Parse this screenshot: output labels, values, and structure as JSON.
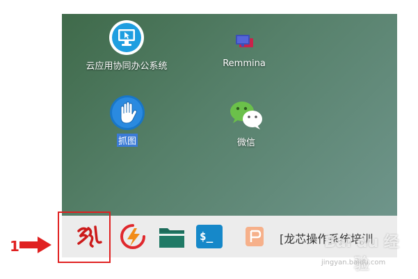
{
  "desktop": {
    "icons": [
      {
        "label": "云应用协同办公系统",
        "icon": "monitor-cursor-icon"
      },
      {
        "label": "Remmina",
        "icon": "remmina-icon"
      },
      {
        "label": "抓图",
        "icon": "hand-icon"
      },
      {
        "label": "微信",
        "icon": "wechat-icon"
      }
    ]
  },
  "taskbar": {
    "start_icon": "start-menu-logo-icon",
    "window_title": "[龙芯操作系统培训"
  },
  "annotation": {
    "number": "1"
  },
  "watermark": {
    "main": "Bai du 经验",
    "sub": "jingyan.baidu.com"
  },
  "colors": {
    "annotation": "#e02020",
    "taskbar": "#ececec",
    "selection": "#3b7bd6"
  }
}
